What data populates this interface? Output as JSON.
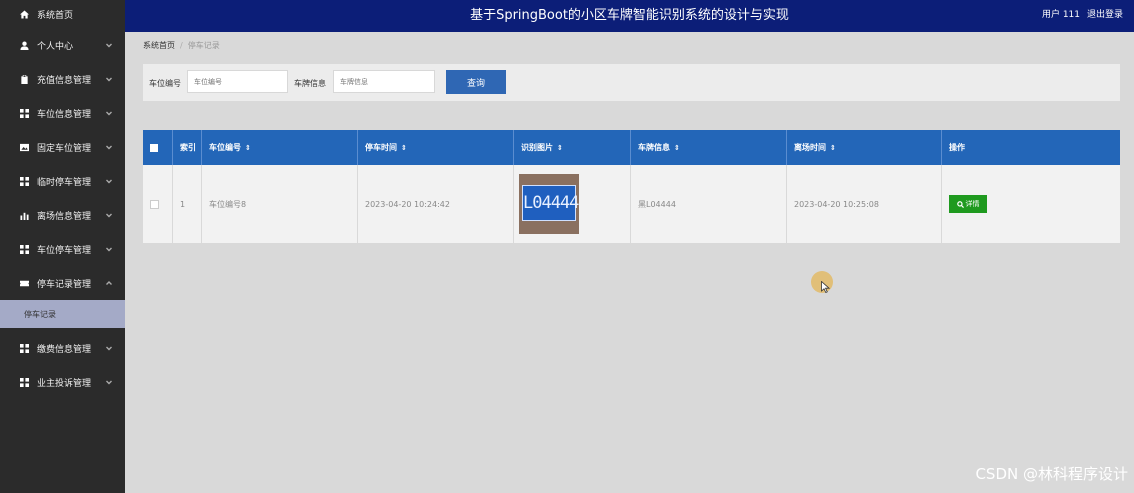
{
  "header": {
    "title": "基于SpringBoot的小区车牌智能识别系统的设计与实现",
    "user": "用户 111",
    "logout": "退出登录"
  },
  "sidebar": {
    "items": [
      {
        "label": "系统首页",
        "icon": "home-icon"
      },
      {
        "label": "个人中心",
        "icon": "user-icon"
      },
      {
        "label": "充值信息管理",
        "icon": "clipboard-icon"
      },
      {
        "label": "车位信息管理",
        "icon": "grid-icon"
      },
      {
        "label": "固定车位管理",
        "icon": "image-icon"
      },
      {
        "label": "临时停车管理",
        "icon": "grid-icon"
      },
      {
        "label": "离场信息管理",
        "icon": "bar-chart-icon"
      },
      {
        "label": "车位停车管理",
        "icon": "grid-icon"
      },
      {
        "label": "停车记录管理",
        "icon": "ticket-icon"
      },
      {
        "label": "缴费信息管理",
        "icon": "grid-icon"
      },
      {
        "label": "业主投诉管理",
        "icon": "grid-icon"
      }
    ],
    "active_sub": "停车记录"
  },
  "breadcrumb": {
    "home": "系统首页",
    "current": "停车记录"
  },
  "search": {
    "field1_label": "车位编号",
    "field1_placeholder": "车位编号",
    "field2_label": "车牌信息",
    "field2_placeholder": "车牌信息",
    "button": "查询"
  },
  "table": {
    "headers": [
      "索引",
      "车位编号",
      "停车时间",
      "识别图片",
      "车牌信息",
      "离场时间",
      "操作"
    ],
    "rows": [
      {
        "index": "1",
        "slot": "车位编号8",
        "park_time": "2023-04-20 10:24:42",
        "plate_text": "L04444",
        "plate_info": "黑L04444",
        "leave_time": "2023-04-20 10:25:08",
        "action": "详情"
      }
    ]
  },
  "watermark": "CSDN @林科程序设计",
  "colors": {
    "header_bg": "#0c1e78",
    "sidebar_bg": "#2b2b2b",
    "table_head": "#2366b8",
    "button": "#2f67b4",
    "detail_button": "#1f9a1f"
  }
}
